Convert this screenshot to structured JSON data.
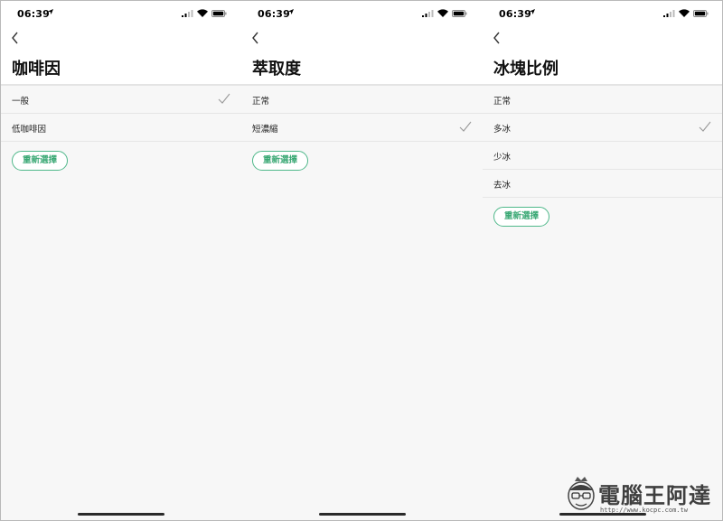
{
  "panels": [
    {
      "time": "06:39",
      "title": "咖啡因",
      "options": [
        {
          "label": "一般",
          "checked": true
        },
        {
          "label": "低咖啡因",
          "checked": false
        }
      ],
      "reset_label": "重新選擇"
    },
    {
      "time": "06:39",
      "title": "萃取度",
      "options": [
        {
          "label": "正常",
          "checked": false
        },
        {
          "label": "短濃縮",
          "checked": true
        }
      ],
      "reset_label": "重新選擇"
    },
    {
      "time": "06:39",
      "title": "冰塊比例",
      "options": [
        {
          "label": "正常",
          "checked": false
        },
        {
          "label": "多冰",
          "checked": true
        },
        {
          "label": "少冰",
          "checked": false
        },
        {
          "label": "去冰",
          "checked": false
        }
      ],
      "reset_label": "重新選擇"
    }
  ],
  "watermark": {
    "brand": "電腦王阿達",
    "url": "http://www.kocpc.com.tw"
  },
  "colors": {
    "accent": "#3aa874",
    "background": "#f7f7f7",
    "check": "#9a9a9a"
  }
}
